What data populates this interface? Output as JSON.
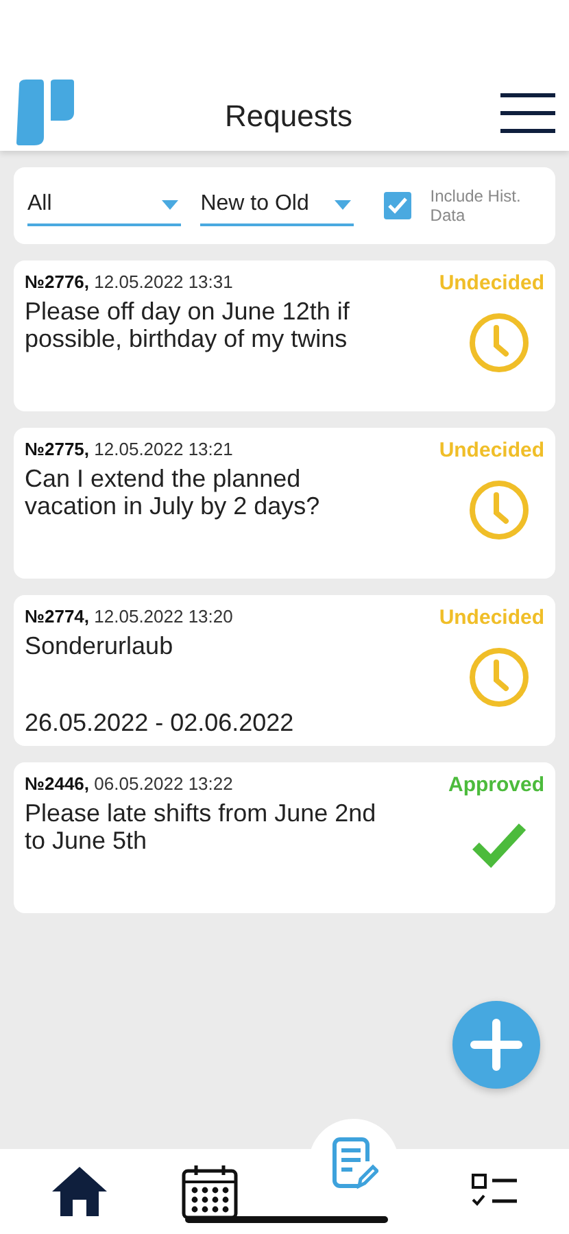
{
  "header": {
    "title": "Requests"
  },
  "filters": {
    "type": "All",
    "order": "New to Old",
    "include_hist": {
      "label": "Include Hist. Data",
      "checked": true
    }
  },
  "requests": [
    {
      "number": "№2776,",
      "date": "12.05.2022 13:31",
      "status": "Undecided",
      "kind": "undecided",
      "text": "Please off day on June 12th if possible, birthday of my twins"
    },
    {
      "number": "№2775,",
      "date": "12.05.2022 13:21",
      "status": "Undecided",
      "kind": "undecided",
      "text": "Can I extend the planned vacation in July by 2 days?"
    },
    {
      "number": "№2774,",
      "date": "12.05.2022 13:20",
      "status": "Undecided",
      "kind": "undecided",
      "text": "Sonderurlaub",
      "dates": "26.05.2022 - 02.06.2022"
    },
    {
      "number": "№2446,",
      "date": "06.05.2022 13:22",
      "status": "Approved",
      "kind": "approved",
      "text": "Please late shifts from June 2nd to June 5th"
    }
  ],
  "nav": [
    {
      "kind": "home",
      "selected": false
    },
    {
      "kind": "calendar",
      "selected": false
    },
    {
      "kind": "requests",
      "selected": true
    },
    {
      "kind": "tasks",
      "selected": false
    }
  ]
}
